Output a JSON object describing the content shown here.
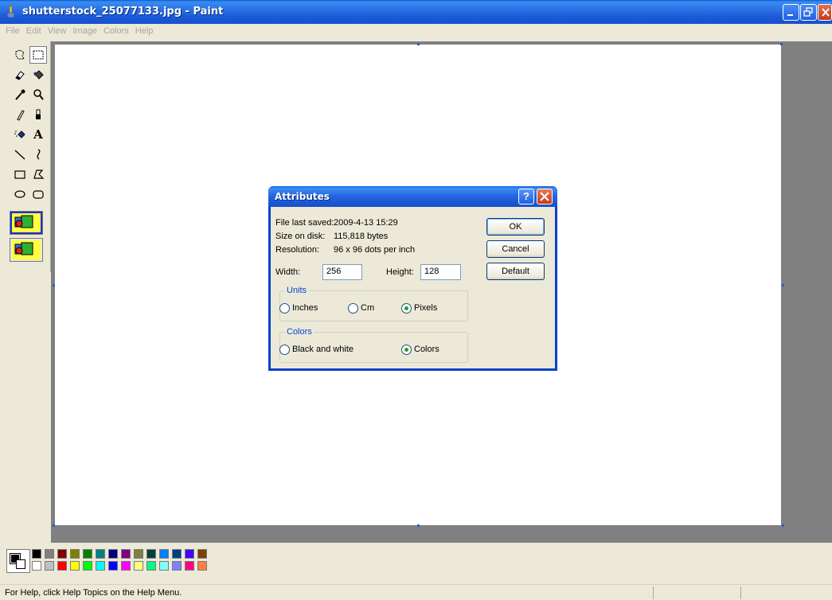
{
  "window": {
    "title": "shutterstock_25077133.jpg - Paint"
  },
  "menu": [
    "File",
    "Edit",
    "View",
    "Image",
    "Colors",
    "Help"
  ],
  "toolbox": {
    "tools": [
      "free-form-select",
      "select",
      "eraser",
      "fill-with-color",
      "pick-color",
      "magnifier",
      "pencil",
      "brush",
      "airbrush",
      "text",
      "line",
      "curve",
      "rectangle",
      "polygon",
      "ellipse",
      "rounded-rectangle"
    ],
    "selected_tool": "select"
  },
  "dialog": {
    "title": "Attributes",
    "file_last_saved_label": "File last saved:",
    "file_last_saved_value": "2009-4-13 15:29",
    "size_on_disk_label": "Size on disk:",
    "size_on_disk_value": "115,818 bytes",
    "resolution_label": "Resolution:",
    "resolution_value": "96 x 96 dots per inch",
    "width_label": "Width:",
    "width_value": "256",
    "height_label": "Height:",
    "height_value": "128",
    "units_legend": "Units",
    "units_options": [
      "Inches",
      "Cm",
      "Pixels"
    ],
    "units_selected": "Pixels",
    "colors_legend": "Colors",
    "colors_options": [
      "Black and white",
      "Colors"
    ],
    "colors_selected": "Colors",
    "ok_label": "OK",
    "cancel_label": "Cancel",
    "default_label": "Default",
    "help_glyph": "?"
  },
  "palette": {
    "foreground": "#000000",
    "background": "#ffffff",
    "top_row": [
      "#000000",
      "#808080",
      "#800000",
      "#808000",
      "#008000",
      "#008080",
      "#000080",
      "#800080",
      "#808040",
      "#004040",
      "#0080ff",
      "#004080",
      "#4000ff",
      "#804000"
    ],
    "bottom_row": [
      "#ffffff",
      "#c0c0c0",
      "#ff0000",
      "#ffff00",
      "#00ff00",
      "#00ffff",
      "#0000ff",
      "#ff00ff",
      "#ffff80",
      "#00ff80",
      "#80ffff",
      "#8080ff",
      "#ff0080",
      "#ff8040"
    ]
  },
  "status": {
    "message": "For Help, click Help Topics on the Help Menu."
  }
}
